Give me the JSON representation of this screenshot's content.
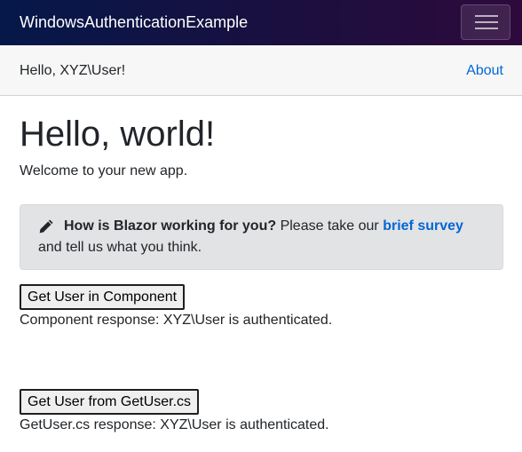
{
  "navbar": {
    "brand": "WindowsAuthenticationExample",
    "toggle_icon": "hamburger-icon"
  },
  "top_row": {
    "greeting": "Hello, XYZ\\User!",
    "about_link": "About"
  },
  "main": {
    "title": "Hello, world!",
    "welcome": "Welcome to your new app.",
    "survey_prompt": {
      "icon": "pencil-icon",
      "question": "How is Blazor working for you?",
      "text_before_link": " Please take our ",
      "link_text": "brief survey",
      "text_after_link": "and tell us what you think."
    },
    "component_button": "Get User in Component",
    "component_response": "Component response: XYZ\\User is authenticated.",
    "getuser_button": "Get User from GetUser.cs",
    "getuser_response": "GetUser.cs response: XYZ\\User is authenticated."
  },
  "colors": {
    "navbar_start": "#05184a",
    "navbar_end": "#2e0a3c",
    "link": "#0366d6",
    "alert_bg": "#e2e3e5",
    "top_row_bg": "#f7f7f7"
  }
}
